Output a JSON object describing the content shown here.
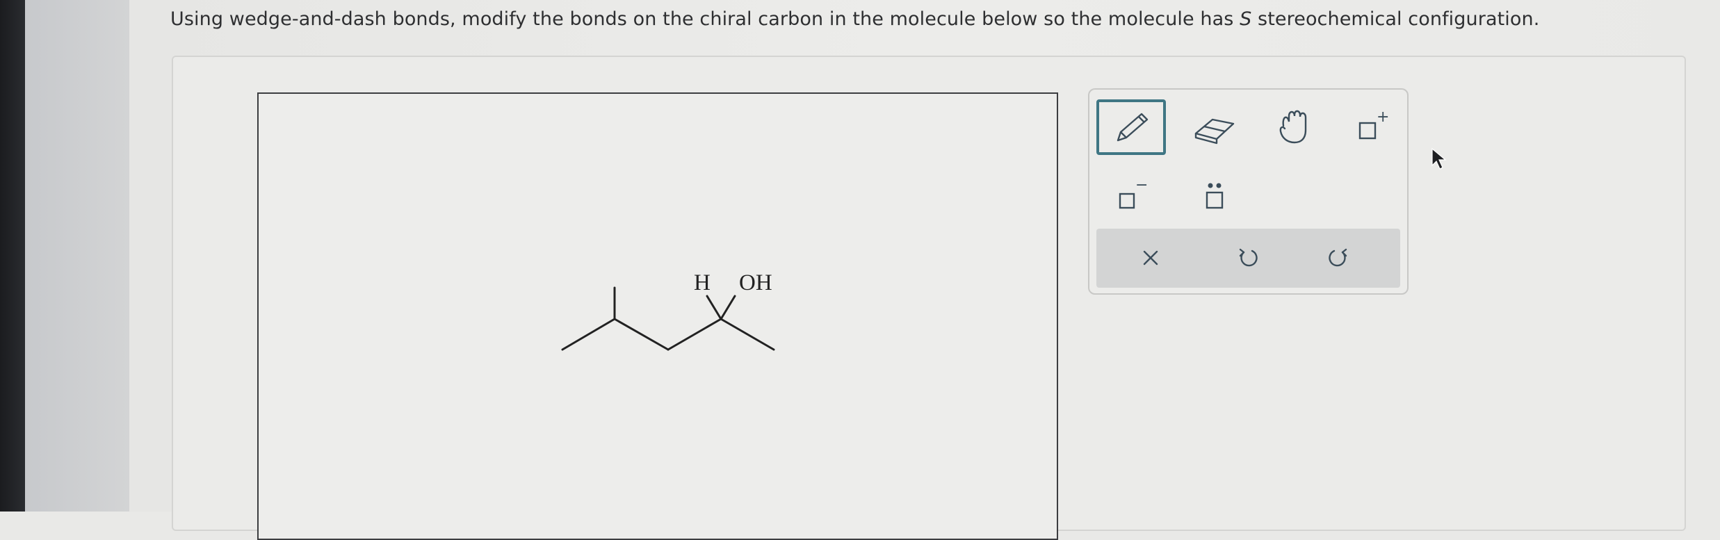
{
  "question": {
    "before_italic": "Using wedge-and-dash bonds, modify the bonds on the chiral carbon in the molecule below so the molecule has ",
    "italic": "S",
    "after_italic": " stereochemical configuration."
  },
  "molecule": {
    "atom_h": "H",
    "atom_oh": "OH"
  },
  "toolbox": {
    "tools": [
      {
        "name": "pencil-icon",
        "selected": true
      },
      {
        "name": "eraser-icon",
        "selected": false
      },
      {
        "name": "hand-icon",
        "selected": false
      },
      {
        "name": "positive-charge-icon",
        "selected": false
      },
      {
        "name": "negative-charge-icon",
        "selected": false
      },
      {
        "name": "lone-pair-icon",
        "selected": false
      }
    ],
    "actions": [
      "clear-icon",
      "undo-icon",
      "redo-icon"
    ],
    "charge_plus": "+",
    "charge_minus": "−"
  },
  "colors": {
    "selected_border": "#3f7684",
    "icon_stroke": "#3b4d5a"
  }
}
